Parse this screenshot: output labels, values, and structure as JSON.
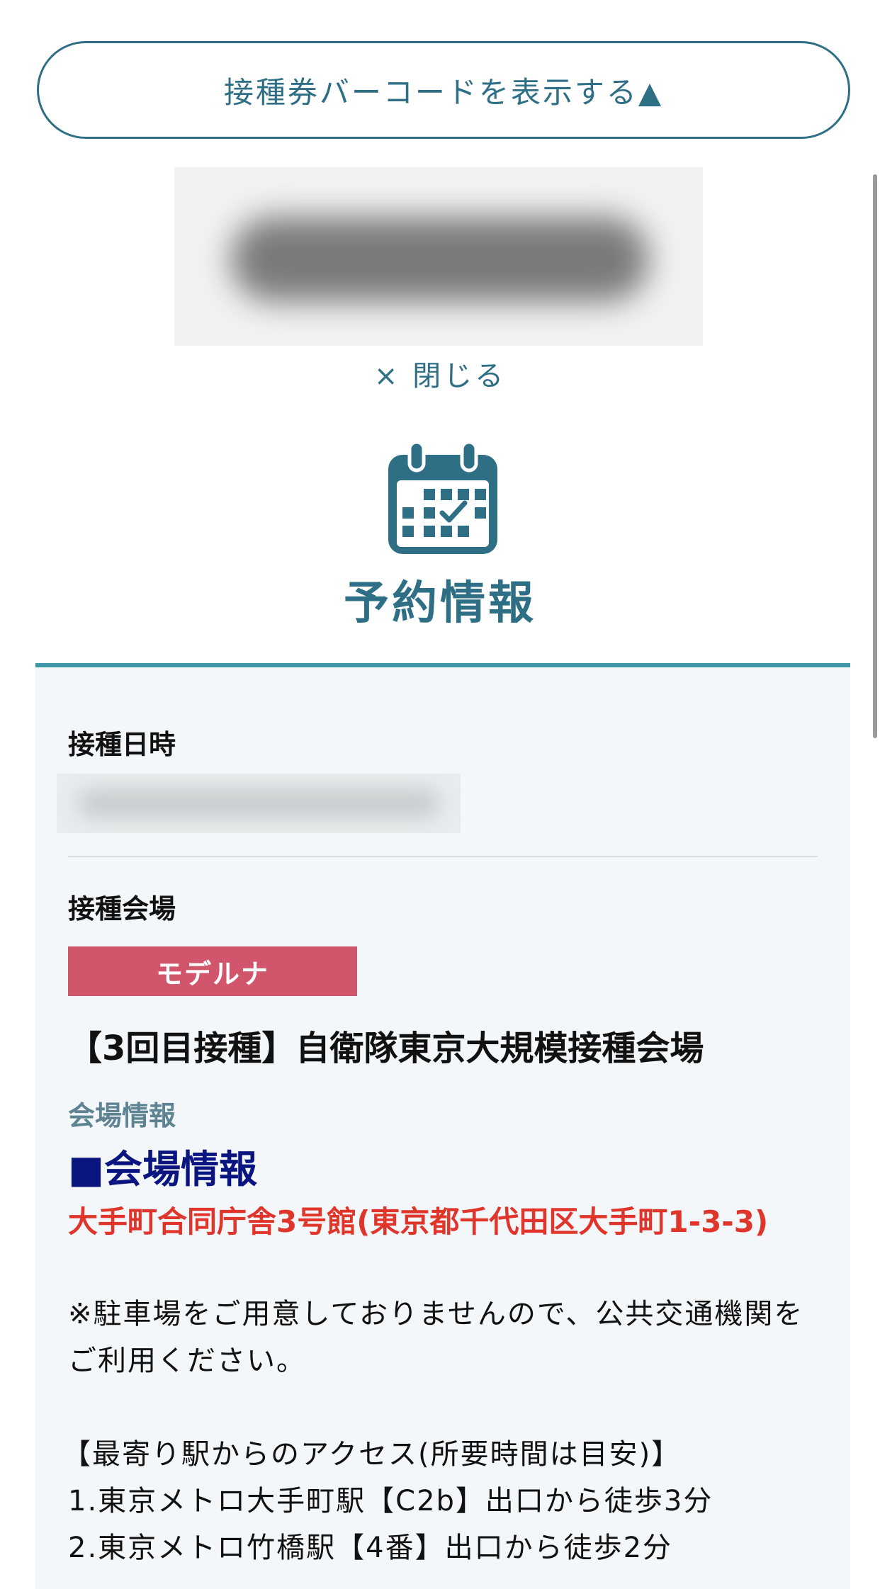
{
  "barcode_toggle": {
    "label": "接種券バーコードを表示する▲"
  },
  "close_link": {
    "label": "× 閉じる"
  },
  "reservation": {
    "title": "予約情報",
    "icon": "calendar-check-icon"
  },
  "details": {
    "date_label": "接種日時",
    "venue_label": "接種会場",
    "vaccine_badge": "モデルナ",
    "venue_name": "【3回目接種】自衛隊東京大規模接種会場",
    "venue_info_label": "会場情報",
    "venue_info_heading": "■会場情報",
    "address": "大手町合同庁舎3号館(東京都千代田区大手町1-3-3)",
    "parking_note": "※駐車場をご用意しておりませんので、公共交通機関をご利用ください。",
    "access_heading": "【最寄り駅からのアクセス(所要時間は目安)】",
    "access_1": "1.東京メトロ大手町駅【C2b】出口から徒歩3分",
    "access_2": "2.東京メトロ竹橋駅【4番】出口から徒歩2分"
  },
  "colors": {
    "primary": "#2e6f86",
    "panel_border": "#3f97a8",
    "badge": "#d1556b",
    "heading_navy": "#0b1580",
    "address_red": "#e0352b"
  }
}
